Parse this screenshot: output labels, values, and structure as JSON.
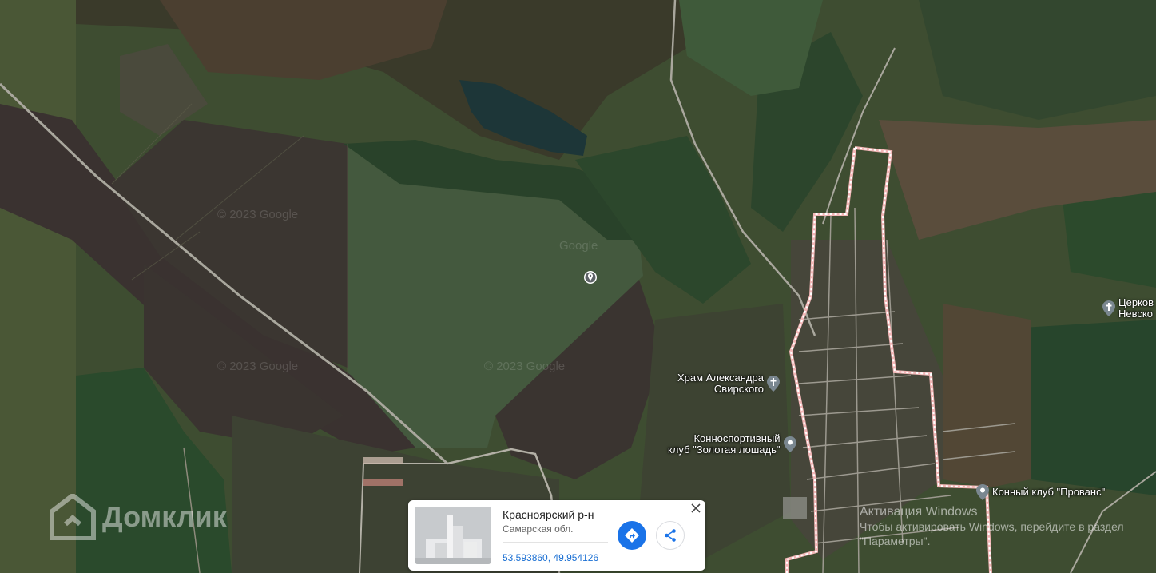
{
  "map": {
    "copyright_marks": [
      "© 2023 Google",
      "© 2023 Google",
      "© 2023 Google",
      "Google"
    ],
    "colors": {
      "field": "#44573a",
      "forest": "#2f4a2c",
      "plowed": "#3b3530",
      "boundary": "#f3b3b3",
      "road": "#c9c5bd",
      "lake": "#1f3a3d"
    }
  },
  "pois": [
    {
      "name": "church-alexander",
      "label_line1": "Храм Александра",
      "label_line2": "Свирского",
      "icon": "cross-pin-icon"
    },
    {
      "name": "equestrian-club",
      "label_line1": "Конноспортивный",
      "label_line2": "клуб \"Золотая лошадь\"",
      "icon": "pin-icon"
    },
    {
      "name": "horse-club-provence",
      "label_line1": "Конный клуб \"Прованс\"",
      "label_line2": "",
      "icon": "pin-icon"
    },
    {
      "name": "church-nevsky",
      "label_line1": "Церков",
      "label_line2": "Невско",
      "icon": "cross-pin-icon"
    }
  ],
  "watermark": {
    "text": "Домклик",
    "icon": "domclick-logo-icon"
  },
  "windows_activation": {
    "title": "Активация Windows",
    "subtitle": "Чтобы активировать Windows, перейдите в раздел \"Параметры\"."
  },
  "place_card": {
    "title": "Красноярский р-н",
    "region": "Самарская обл.",
    "coordinates": "53.593860, 49.954126",
    "route_icon": "directions-icon",
    "share_icon": "share-icon",
    "close_icon": "close-icon",
    "thumbnail_icon": "building-placeholder-icon"
  }
}
